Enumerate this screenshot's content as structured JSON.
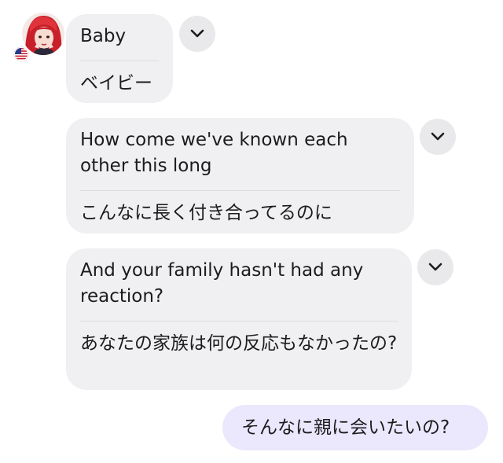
{
  "contact": {
    "avatar_icon": "avatar-icon",
    "flag_icon": "us-flag-icon"
  },
  "messages": [
    {
      "original": "Baby",
      "translation": "ベイビー"
    },
    {
      "original": "How come we've known each other this long",
      "translation": "こんなに長く付き合ってるのに"
    },
    {
      "original": "And your family hasn't had any reaction?",
      "translation": "あなたの家族は何の反応もなかったの?"
    }
  ],
  "reply": {
    "text": "そんなに親に会いたいの?"
  },
  "colors": {
    "incoming_bubble": "#f0f0f2",
    "outgoing_bubble": "#ebe8fd",
    "chevron_button": "#e9e9eb"
  }
}
